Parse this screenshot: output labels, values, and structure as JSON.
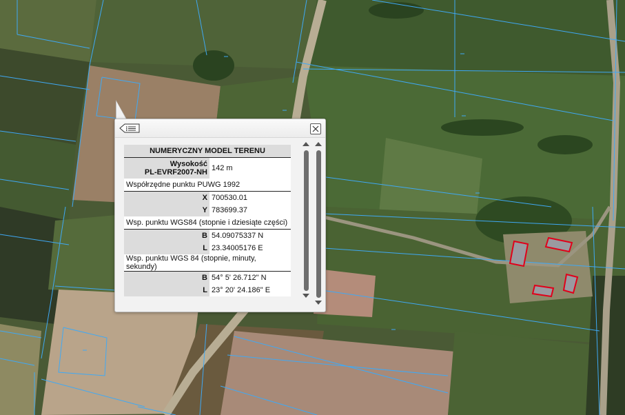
{
  "popup": {
    "title": "NUMERYCZNY MODEL TERENU",
    "height_label_line1": "Wysokość",
    "height_label_line2": "PL-EVRF2007-NH",
    "height_value": "142 m",
    "puwg_header": "Współrzędne punktu PUWG 1992",
    "puwg_x_label": "X",
    "puwg_x_value": "700530.01",
    "puwg_y_label": "Y",
    "puwg_y_value": "783699.37",
    "wgs_dec_header": "Wsp. punktu WGS84 (stopnie i dziesiąte części)",
    "wgs_dec_b_label": "B",
    "wgs_dec_b_value": "54.09075337 N",
    "wgs_dec_l_label": "L",
    "wgs_dec_l_value": "23.34005176 E",
    "wgs_dms_header": "Wsp. punktu WGS 84 (stopnie, minuty, sekundy)",
    "wgs_dms_b_label": "B",
    "wgs_dms_b_value": "54° 5' 26.712\" N",
    "wgs_dms_l_label": "L",
    "wgs_dms_l_value": "23° 20' 24.186\" E"
  },
  "icons": {
    "list": "list-icon",
    "close": "close-icon"
  },
  "colors": {
    "parcel_lines": "#3fa9f5",
    "buildings": "#e0001a"
  }
}
